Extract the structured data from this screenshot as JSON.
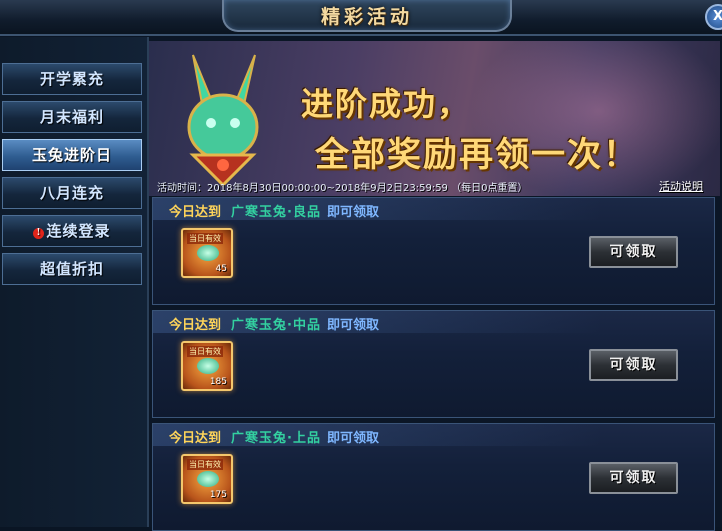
{
  "window": {
    "title": "精彩活动",
    "close_label": "X"
  },
  "sidebar": {
    "items": [
      {
        "label": "开学累充"
      },
      {
        "label": "月末福利"
      },
      {
        "label": "玉兔进阶日",
        "active": true
      },
      {
        "label": "八月连充"
      },
      {
        "label": "连续登录",
        "alert": "!"
      },
      {
        "label": "超值折扣"
      }
    ]
  },
  "banner": {
    "headline_line1": "进阶成功，",
    "headline_line2": "全部奖励再领一次！",
    "activity_time": "活动时间：2018年8月30日00:00:00~2018年9月2日23:59:59 （每日0点重置）",
    "rules_link": "活动说明"
  },
  "rewards": [
    {
      "today": "今日达到",
      "item": "广寒玉兔·良品",
      "claim_text": "即可领取",
      "icon_tag": "当日有效",
      "count": "45",
      "button": "可领取"
    },
    {
      "today": "今日达到",
      "item": "广寒玉兔·中品",
      "claim_text": "即可领取",
      "icon_tag": "当日有效",
      "count": "185",
      "button": "可领取"
    },
    {
      "today": "今日达到",
      "item": "广寒玉兔·上品",
      "claim_text": "即可领取",
      "icon_tag": "当日有效",
      "count": "175",
      "button": "可领取"
    }
  ],
  "colors": {
    "accent_gold": "#ffd877",
    "item_green": "#33d0a0",
    "claim_blue": "#7fb7ff"
  }
}
